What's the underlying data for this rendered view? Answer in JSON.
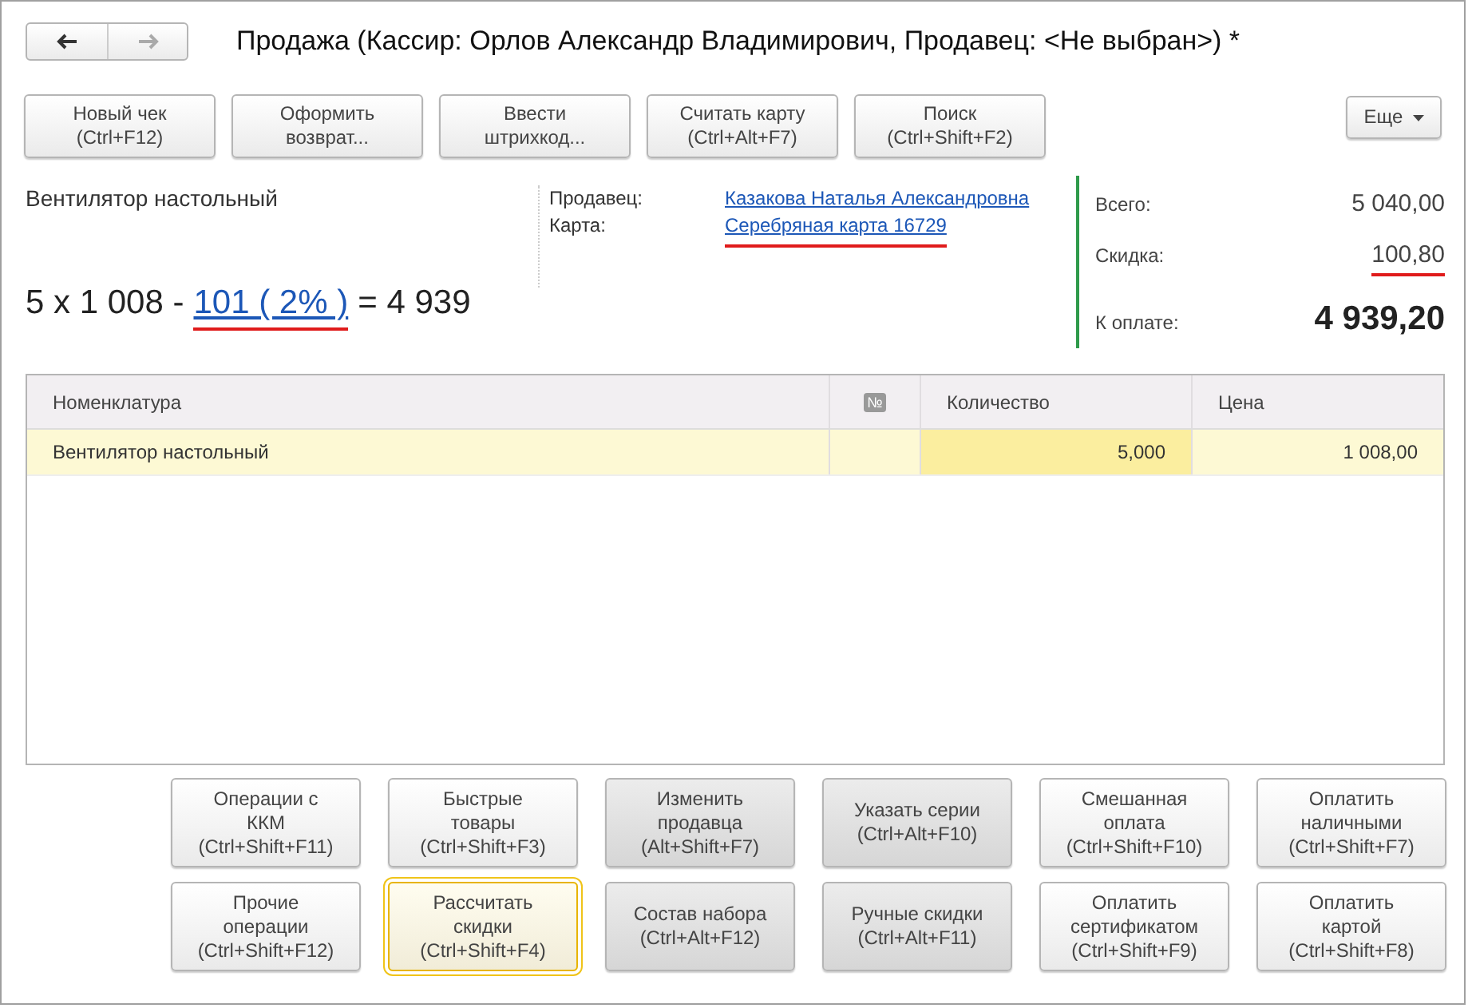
{
  "window": {
    "title": "Продажа (Кассир: Орлов Александр Владимирович, Продавец: <Не выбран>) *"
  },
  "nav": [
    {
      "kind": "back",
      "disabled": false
    },
    {
      "kind": "forward",
      "disabled": true
    }
  ],
  "toolbar": [
    {
      "label": "Новый чек\n(Ctrl+F12)"
    },
    {
      "label": "Оформить\nвозврат..."
    },
    {
      "label": "Ввести\nштрихкод..."
    },
    {
      "label": "Считать карту\n(Ctrl+Alt+F7)"
    },
    {
      "label": "Поиск\n(Ctrl+Shift+F2)"
    }
  ],
  "more_button": {
    "label": "Еще"
  },
  "item": {
    "name": "Вентилятор настольный",
    "calc_prefix": "5 x 1 008 -",
    "discount_link": "101 ( 2% )",
    "discount_underlined": true,
    "calc_suffix": "= 4 939"
  },
  "details": [
    {
      "label": "Продавец:",
      "value": "Казакова Наталья Александровна",
      "underlined": false
    },
    {
      "label": "Карта:",
      "value": "Серебряная карта 16729",
      "underlined": true
    }
  ],
  "totals": [
    {
      "label": "Всего:",
      "value": "5 040,00",
      "underlined": false,
      "bold": false
    },
    {
      "label": "Скидка:",
      "value": "100,80",
      "underlined": true,
      "bold": false
    },
    {
      "label": "К оплате:",
      "value": "4 939,20",
      "underlined": false,
      "bold": true
    }
  ],
  "table": {
    "columns": [
      {
        "label": "Номенклатура",
        "kind": "text"
      },
      {
        "label": "№",
        "kind": "icon"
      },
      {
        "label": "Количество",
        "kind": "text"
      },
      {
        "label": "Цена",
        "kind": "text"
      }
    ],
    "rows": [
      {
        "selected": true,
        "cells": [
          "Вентилятор настольный",
          "",
          "5,000",
          "1 008,00"
        ]
      }
    ]
  },
  "actions": [
    [
      {
        "label": "Операции с\nККМ\n(Ctrl+Shift+F11)",
        "shaded": false,
        "focused": false
      },
      {
        "label": "Быстрые\nтовары\n(Ctrl+Shift+F3)",
        "shaded": false,
        "focused": false
      },
      {
        "label": "Изменить\nпродавца\n(Alt+Shift+F7)",
        "shaded": true,
        "focused": false
      },
      {
        "label": "Указать серии\n(Ctrl+Alt+F10)",
        "shaded": true,
        "focused": false
      },
      {
        "label": "Смешанная\nоплата\n(Ctrl+Shift+F10)",
        "shaded": false,
        "focused": false
      },
      {
        "label": "Оплатить\nналичными\n(Ctrl+Shift+F7)",
        "shaded": false,
        "focused": false
      }
    ],
    [
      {
        "label": "Прочие\nоперации\n(Ctrl+Shift+F12)",
        "shaded": false,
        "focused": false
      },
      {
        "label": "Рассчитать\nскидки\n(Ctrl+Shift+F4)",
        "shaded": false,
        "focused": true
      },
      {
        "label": "Состав набора\n(Ctrl+Alt+F12)",
        "shaded": true,
        "focused": false
      },
      {
        "label": "Ручные скидки\n(Ctrl+Alt+F11)",
        "shaded": true,
        "focused": false
      },
      {
        "label": "Оплатить\nсертификатом\n(Ctrl+Shift+F9)",
        "shaded": false,
        "focused": false
      },
      {
        "label": "Оплатить\nкартой\n(Ctrl+Shift+F8)",
        "shaded": false,
        "focused": false
      }
    ]
  ]
}
